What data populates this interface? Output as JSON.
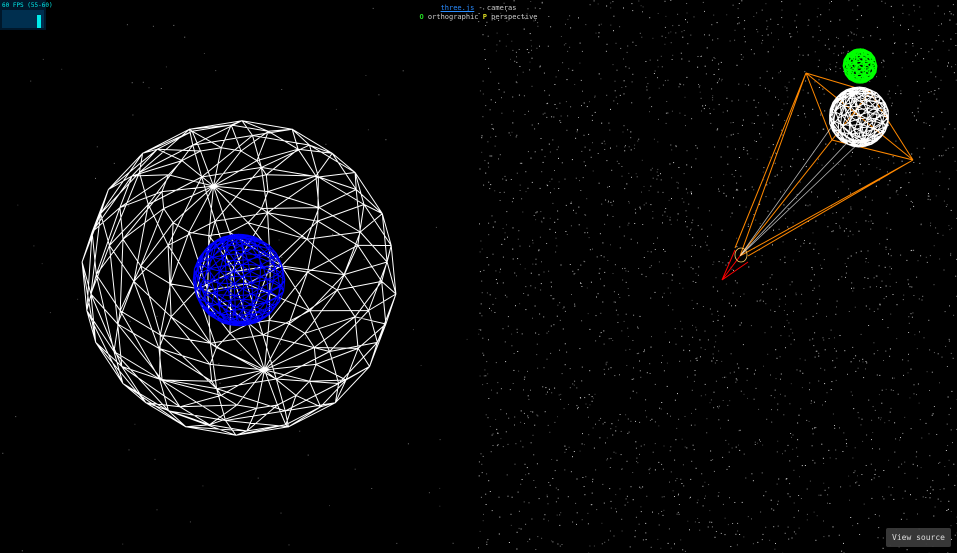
{
  "info": {
    "link_text": "three.js",
    "subtitle": "- cameras",
    "key_o": "O",
    "label_o": "orthographic",
    "key_p": "P",
    "label_p": "perspective"
  },
  "stats": {
    "text": "60 FPS (55-60)",
    "level": 0.7
  },
  "view_source_label": "View source",
  "colors": {
    "background": "#000000",
    "big_sphere": "#ffffff",
    "inner_sphere": "#0000ff",
    "small_white_sphere": "#ffffff",
    "green_sphere": "#00ff00",
    "frustum": "#ff8800",
    "camera_helper_red": "#ff0000",
    "stars": "#888888"
  }
}
